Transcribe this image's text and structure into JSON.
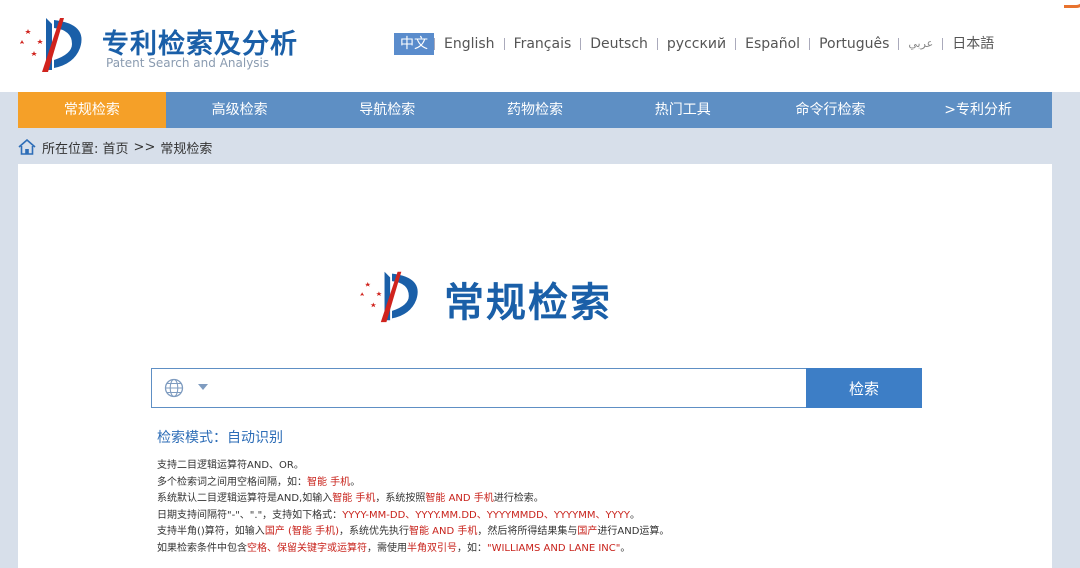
{
  "header": {
    "title": "专利检索及分析",
    "subtitle": "Patent Search and Analysis"
  },
  "languages": [
    "中文",
    "English",
    "Français",
    "Deutsch",
    "русский",
    "Español",
    "Português",
    "عربي",
    "日本語"
  ],
  "nav": {
    "items": [
      "常规检索",
      "高级检索",
      "导航检索",
      "药物检索",
      "热门工具",
      "命令行检索",
      ">专利分析"
    ]
  },
  "breadcrumb": {
    "label": "所在位置:",
    "home": "首页",
    "sep": ">>",
    "current": "常规检索"
  },
  "main": {
    "title": "常规检索",
    "search": {
      "value": "",
      "placeholder": "",
      "button": "检索"
    },
    "mode": "检索模式：自动识别",
    "tips": {
      "l1": {
        "a": "支持二目逻辑运算符AND、OR。"
      },
      "l2": {
        "a": "多个检索词之间用空格间隔，如：",
        "b": "智能 手机",
        "c": "。"
      },
      "l3": {
        "a": "系统默认二目逻辑运算符是AND,如输入",
        "b": "智能 手机",
        "c": "，系统按照",
        "d": "智能 AND 手机",
        "e": "进行检索。"
      },
      "l4": {
        "a": "日期支持间隔符\"-\"、\".\"，支持如下格式：",
        "b": "YYYY-MM-DD、YYYY.MM.DD、YYYYMMDD、YYYYMM、YYYY",
        "c": "。"
      },
      "l5": {
        "a": "支持半角()算符，如输入",
        "b": "国产 (智能 手机)",
        "c": "，系统优先执行",
        "d": "智能 AND 手机",
        "e": "，然后将所得结果集与",
        "f": "国产",
        "g": "进行AND运算。"
      },
      "l6": {
        "a": "如果检索条件中包含",
        "b": "空格、保留关键字或运算符",
        "c": "，需使用",
        "d": "半角双引号",
        "e": "，如：",
        "f": "\"WILLIAMS AND LANE INC\"",
        "g": "。"
      }
    }
  },
  "colors": {
    "brand": "#1a5fa8",
    "nav": "#5e8fc4",
    "nav_active": "#f5a028",
    "highlight": "#c8221b"
  }
}
